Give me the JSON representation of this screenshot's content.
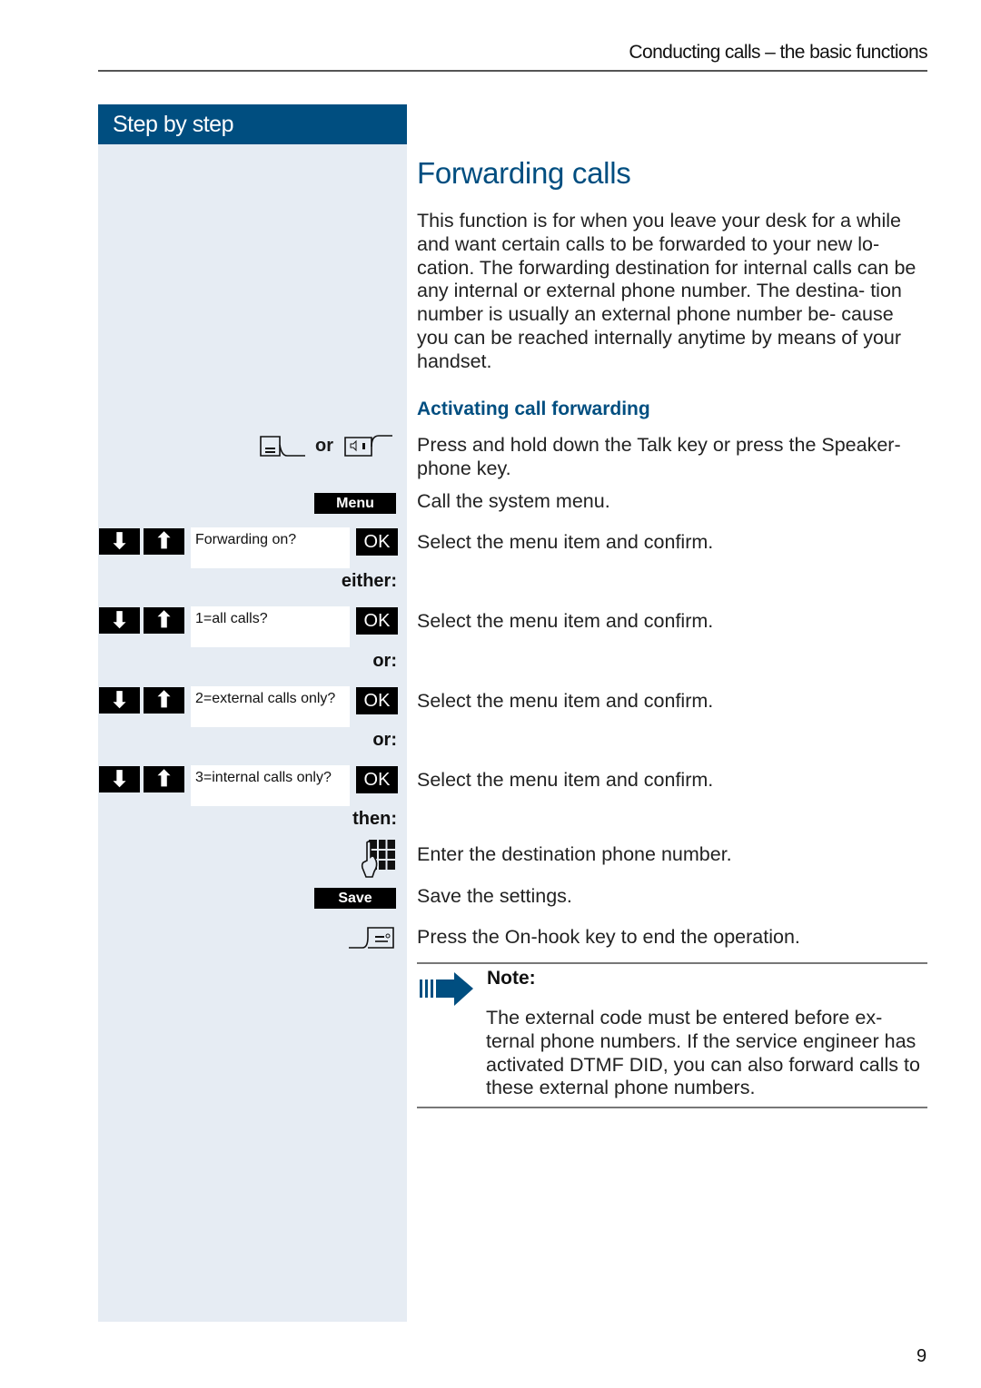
{
  "header": {
    "title": "Conducting calls – the basic functions"
  },
  "sidebar": {
    "heading": "Step by step"
  },
  "main": {
    "title": "Forwarding calls",
    "intro": "This function is for when you leave your desk for a while and want certain calls to be forwarded to your new lo- cation. The forwarding destination for internal calls can be any internal or external phone number. The destina- tion number is usually an external phone number be- cause you can be reached internally anytime by means of your handset.",
    "subheading": "Activating call forwarding",
    "steps": [
      {
        "text": "Press and hold down the Talk key or press the Speaker- phone key."
      },
      {
        "text": "Call the system menu."
      },
      {
        "text": "Select the menu item and confirm."
      },
      {
        "text": "Select the menu item and confirm."
      },
      {
        "text": "Select the menu item and confirm."
      },
      {
        "text": "Select the menu item and confirm."
      },
      {
        "text": "Enter the destination phone number."
      },
      {
        "text": "Save the settings."
      },
      {
        "text": "Press the On-hook key to end the operation."
      }
    ],
    "note": {
      "label": "Note:",
      "text": "The external code must be entered before ex- ternal phone numbers. If the service engineer has activated DTMF DID, you can also forward calls to these external phone numbers."
    }
  },
  "keys": {
    "or_label": "or",
    "menu_label": "Menu",
    "save_label": "Save",
    "ok_label": "OK",
    "down_arrow": "⬇",
    "up_arrow": "⬆"
  },
  "display": {
    "forwarding_on": "Forwarding on?",
    "all_calls": "1=all calls?",
    "external_only": "2=external calls only?",
    "internal_only": "3=internal calls only?"
  },
  "conjunctions": {
    "either": "either:",
    "or1": "or:",
    "or2": "or:",
    "then": "then:"
  },
  "footer": {
    "page_number": "9"
  },
  "colors": {
    "brand": "#004e80",
    "sidebar_bg": "#e6ecf3"
  }
}
